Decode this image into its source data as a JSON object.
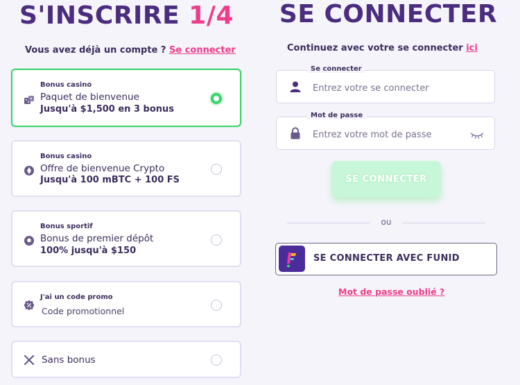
{
  "signup": {
    "title": "S'INSCRIRE",
    "step": "1/4",
    "have_account": "Vous avez déjà un compte ?",
    "login_link": "Se connecter",
    "options": [
      {
        "category": "Bonus casino",
        "name": "Paquet de bienvenue",
        "amount": "Jusqu'à $1,500 en 3 bonus",
        "icon": "dice-icon",
        "selected": true
      },
      {
        "category": "Bonus casino",
        "name": "Offre de bienvenue Crypto",
        "amount": "Jusqu'à 100 mBTC + 100 FS",
        "icon": "crypto-coin-icon",
        "selected": false
      },
      {
        "category": "Bonus sportif",
        "name": "Bonus de premier dépôt",
        "amount": "100% jusqu'à $150",
        "icon": "soccer-ball-icon",
        "selected": false
      },
      {
        "category": "J'ai un code promo",
        "name": "Code promotionnel",
        "icon": "promo-badge-icon",
        "selected": false
      },
      {
        "name": "Sans bonus",
        "icon": "x-icon",
        "selected": false
      }
    ]
  },
  "login": {
    "title": "SE CONNECTER",
    "subtitle": "Continuez avec votre se connecter",
    "subtitle_link": "ici",
    "username_label": "Se connecter",
    "username_placeholder": "Entrez votre se connecter",
    "password_label": "Mot de passe",
    "password_placeholder": "Entrez votre mot de passe",
    "submit_label": "SE CONNECTER",
    "or_text": "ou",
    "funid_label": "SE CONNECTER AVEC FUNID",
    "forgot_label": "Mot de passe oublié ?"
  },
  "colors": {
    "purple": "#4a2d7e",
    "pink": "#ee3d8a",
    "green": "#3bd36b",
    "background": "#f5f4fb"
  }
}
